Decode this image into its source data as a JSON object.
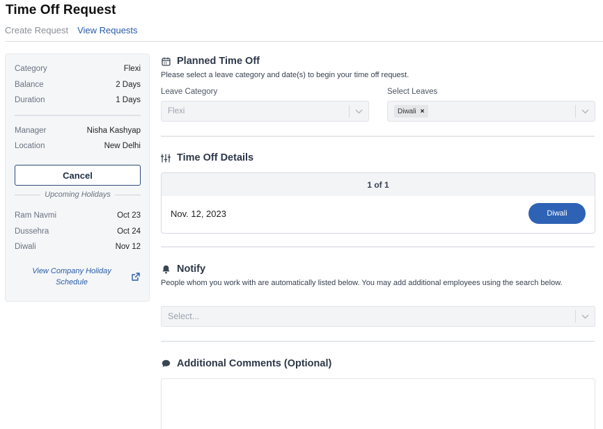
{
  "page": {
    "title": "Time Off Request",
    "tabs": [
      {
        "label": "Create Request"
      },
      {
        "label": "View Requests"
      }
    ]
  },
  "sidebar": {
    "info": [
      {
        "key": "Category",
        "value": "Flexi"
      },
      {
        "key": "Balance",
        "value": "2 Days"
      },
      {
        "key": "Duration",
        "value": "1 Days"
      },
      {
        "key": "Manager",
        "value": "Nisha Kashyap"
      },
      {
        "key": "Location",
        "value": "New Delhi"
      }
    ],
    "cancel_label": "Cancel",
    "upcoming_title": "Upcoming Holidays",
    "holidays": [
      {
        "name": "Ram Navmi",
        "date": "Oct 23"
      },
      {
        "name": "Dussehra",
        "date": "Oct 24"
      },
      {
        "name": "Diwali",
        "date": "Nov 12"
      }
    ],
    "holiday_link": "View Company Holiday Schedule",
    "link_icon": "external-link-icon"
  },
  "planned": {
    "title": "Planned Time Off",
    "icon": "calendar-icon",
    "description": "Please select a leave category and date(s) to begin your time off request.",
    "leave_category_label": "Leave Category",
    "leave_category_value": "Flexi",
    "select_leaves_label": "Select Leaves",
    "selected_leave_chip": "Diwali"
  },
  "details": {
    "title": "Time Off Details",
    "icon": "sliders-icon",
    "pager": "1 of 1",
    "date": "Nov. 12, 2023",
    "holiday_pill": "Diwali"
  },
  "notify": {
    "title": "Notify",
    "icon": "bell-icon",
    "description": "People whom you work with are automatically listed below. You may add additional employees using the search below.",
    "placeholder": "Select..."
  },
  "comments": {
    "title": "Additional Comments (Optional)",
    "icon": "comment-icon",
    "value": ""
  },
  "colors": {
    "accent": "#2d62b5",
    "link": "#2a5ba8",
    "sidebar_bg": "#f4f6f8"
  }
}
